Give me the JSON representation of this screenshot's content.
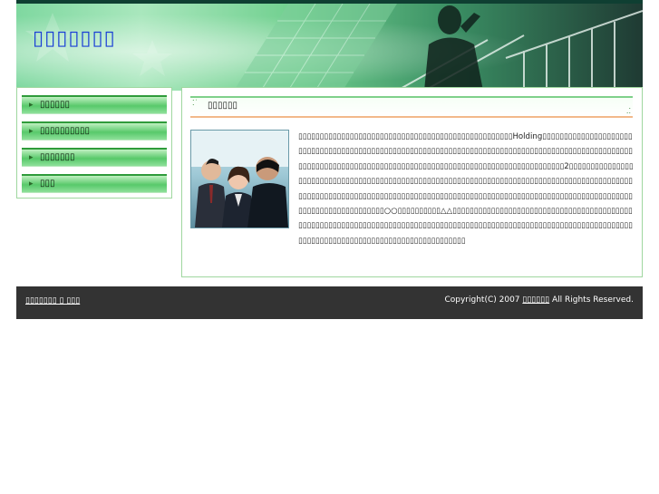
{
  "header": {
    "site_title": "▯▯▯▯▯▯▯"
  },
  "sidebar": {
    "items": [
      {
        "label": "▯▯▯▯▯▯"
      },
      {
        "label": "▯▯▯▯▯▯▯▯▯▯"
      },
      {
        "label": "▯▯▯▯▯▯▯"
      },
      {
        "label": "▯▯▯"
      }
    ],
    "bullet": "▸"
  },
  "main": {
    "section_title": "▯▯▯▯▯▯",
    "photo_alt": "business people",
    "body": "▯▯▯▯▯▯▯▯▯▯▯▯▯▯▯▯▯▯▯▯▯▯▯▯▯▯▯▯▯▯▯▯▯▯▯▯▯▯▯▯▯▯▯▯▯▯▯▯▯▯Holding▯▯▯▯▯▯▯▯▯▯▯▯▯▯▯▯▯▯▯▯▯▯▯▯▯▯▯▯▯▯▯▯▯▯▯▯▯▯▯▯▯▯▯▯▯▯▯▯▯▯▯▯▯▯▯▯▯▯▯▯▯▯▯▯▯▯▯▯▯▯▯▯▯▯▯▯▯▯▯▯▯▯▯▯▯▯▯▯▯▯▯▯▯▯▯▯▯▯▯▯▯▯▯▯▯▯▯▯▯▯▯▯▯▯▯▯▯▯▯▯▯▯▯▯▯▯▯▯▯▯▯▯▯▯▯▯▯▯▯▯▯▯▯▯▯▯▯▯▯▯▯▯▯▯▯▯▯▯▯▯▯2▯▯▯▯▯▯▯▯▯▯▯▯▯▯▯▯▯▯▯▯▯▯▯▯▯▯▯▯▯▯▯▯▯▯▯▯▯▯▯▯▯▯▯▯▯▯▯▯▯▯▯▯▯▯▯▯▯▯▯▯▯▯▯▯▯▯▯▯▯▯▯▯▯▯▯▯▯▯▯▯▯▯▯▯▯▯▯▯▯▯▯▯▯▯▯▯▯▯▯▯▯▯▯▯▯▯▯▯▯▯▯▯▯▯▯▯▯▯▯▯▯▯▯▯▯▯▯▯▯▯▯▯▯▯▯▯▯▯▯▯▯▯▯▯▯▯▯▯▯▯▯▯▯▯▯▯▯▯▯▯▯▯▯▯▯▯▯▯▯▯▯▯▯▯▯▯▯▯▯▯▯▯▯▯▯▯▯▯▯▯▯○○▯▯▯▯▯▯▯▯▯▯△△▯▯▯▯▯▯▯▯▯▯▯▯▯▯▯▯▯▯▯▯▯▯▯▯▯▯▯▯▯▯▯▯▯▯▯▯▯▯▯▯▯▯▯▯▯▯▯▯▯▯▯▯▯▯▯▯▯▯▯▯▯▯▯▯▯▯▯▯▯▯▯▯▯▯▯▯▯▯▯▯▯▯▯▯▯▯▯▯▯▯▯▯▯▯▯▯▯▯▯▯▯▯▯▯▯▯▯▯▯▯▯▯▯▯▯▯▯▯▯▯▯▯▯▯▯▯▯▯▯▯▯▯▯▯▯▯▯▯▯▯▯▯▯▯▯▯▯▯▯▯▯▯▯▯▯▯▯▯▯"
  },
  "footer": {
    "left_link": "▯▯▯▯▯▯▯ ▯ ▯▯▯",
    "copyright_prefix": "Copyright(C) 2007 ",
    "copyright_link": "▯▯▯▯▯▯",
    "copyright_suffix": " All Rights Reserved."
  },
  "colors": {
    "title_blue": "#1a3fd6",
    "nav_green": "#58c96a",
    "footer_bg": "#333333",
    "border_green": "#9fd79f"
  }
}
